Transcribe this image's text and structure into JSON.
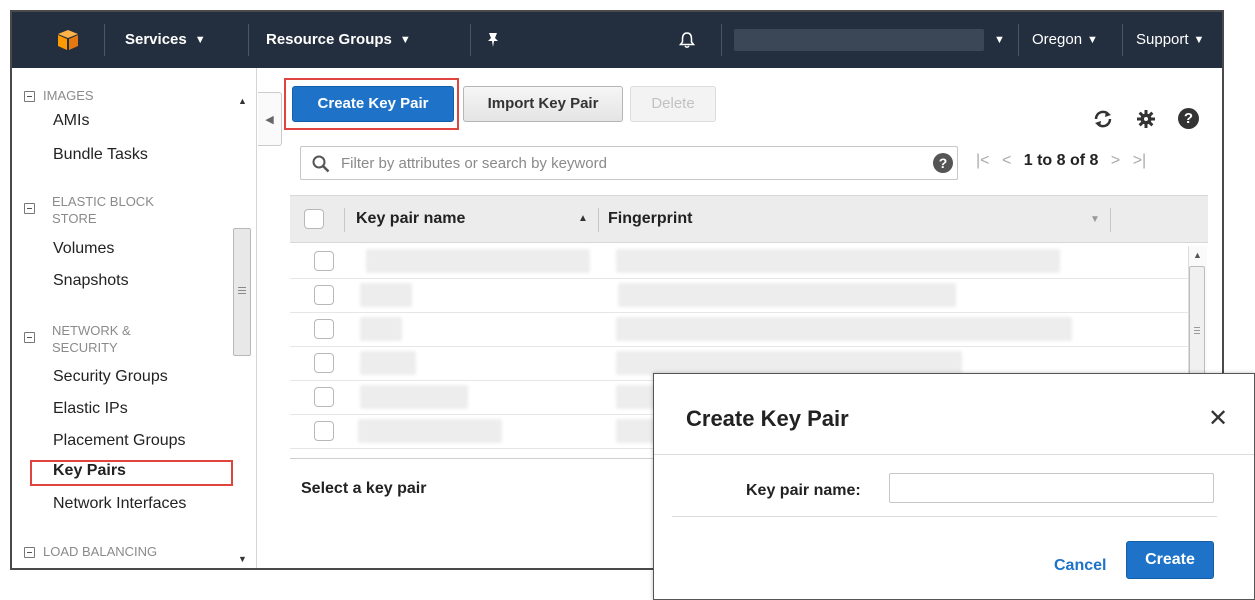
{
  "topnav": {
    "services": "Services",
    "resource_groups": "Resource Groups",
    "region": "Oregon",
    "support": "Support"
  },
  "sidebar": {
    "sections": [
      {
        "title": "IMAGES",
        "items": [
          "AMIs",
          "Bundle Tasks"
        ]
      },
      {
        "title": "ELASTIC BLOCK STORE",
        "items": [
          "Volumes",
          "Snapshots"
        ]
      },
      {
        "title": "NETWORK & SECURITY",
        "items": [
          "Security Groups",
          "Elastic IPs",
          "Placement Groups",
          "Key Pairs",
          "Network Interfaces"
        ]
      },
      {
        "title": "LOAD BALANCING",
        "items": []
      }
    ],
    "elastic_block_line1": "ELASTIC BLOCK",
    "elastic_block_line2": "STORE",
    "network_line1": "NETWORK &",
    "network_line2": "SECURITY",
    "selected_item": "Key Pairs"
  },
  "toolbar": {
    "create_label": "Create Key Pair",
    "import_label": "Import Key Pair",
    "delete_label": "Delete"
  },
  "filter": {
    "placeholder": "Filter by attributes or search by keyword"
  },
  "pager": {
    "text": "1 to 8 of 8"
  },
  "table": {
    "columns": [
      "Key pair name",
      "Fingerprint"
    ]
  },
  "details": {
    "label": "Select a key pair"
  },
  "modal": {
    "title": "Create Key Pair",
    "field_label": "Key pair name:",
    "field_value": "",
    "cancel_label": "Cancel",
    "create_label": "Create"
  },
  "colors": {
    "nav_bg": "#232f3e",
    "primary_button": "#1e73c9",
    "highlight": "#e0443f",
    "logo": "#f90"
  }
}
